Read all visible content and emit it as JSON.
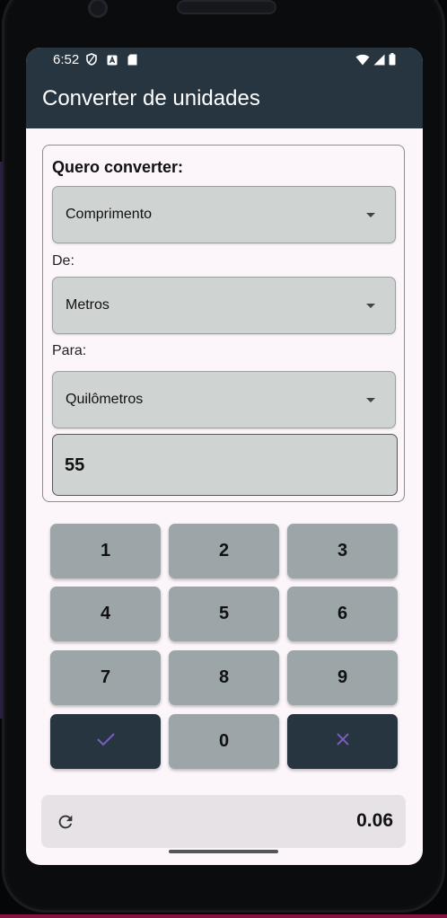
{
  "status": {
    "time": "6:52",
    "left_icons": [
      "vpn-shield-icon",
      "a-notification-icon",
      "sd-card-icon"
    ],
    "right_icons": [
      "wifi-icon",
      "signal-icon",
      "battery-icon"
    ]
  },
  "app": {
    "title": "Converter de unidades"
  },
  "converter": {
    "heading": "Quero converter:",
    "category": "Comprimento",
    "from_label": "De:",
    "from_unit": "Metros",
    "to_label": "Para:",
    "to_unit": "Quilômetros",
    "input_value": "55"
  },
  "keypad": {
    "keys": [
      "1",
      "2",
      "3",
      "4",
      "5",
      "6",
      "7",
      "8",
      "9",
      "0"
    ],
    "confirm_icon": "check-icon",
    "clear_icon": "close-icon"
  },
  "result": {
    "icon": "refresh-icon",
    "value": "0.06"
  },
  "colors": {
    "app_bar": "#263540",
    "field_bg": "#cfd3d1",
    "key_bg": "#9ca6a9",
    "icon_accent": "#7b5cc0"
  }
}
